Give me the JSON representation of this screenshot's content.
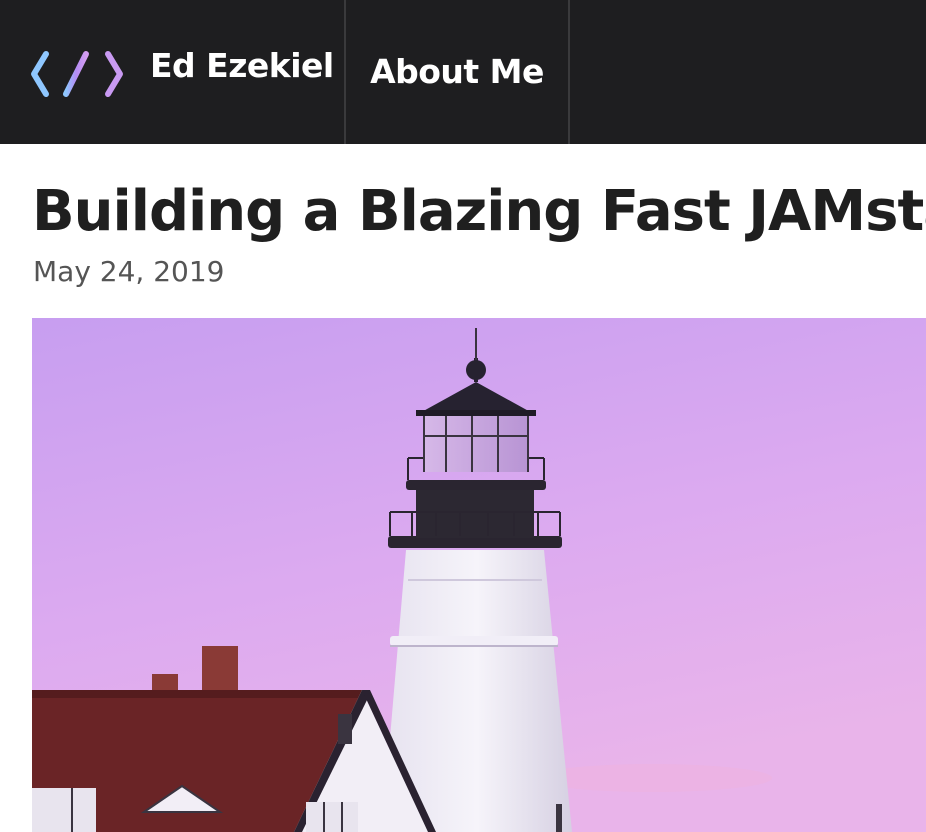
{
  "header": {
    "brand_name": "Ed Ezekiel",
    "logo_icon": "code-brackets-icon",
    "nav": [
      {
        "label": "About Me"
      }
    ],
    "colors": {
      "background": "#1e1e20",
      "logo_gradient": [
        "#8fc7ff",
        "#b48cf5",
        "#d49cf0"
      ]
    }
  },
  "post": {
    "title": "Building a Blazing Fast JAMstack",
    "date": "May 24, 2019",
    "hero_image": "lighthouse-at-dusk-image"
  }
}
